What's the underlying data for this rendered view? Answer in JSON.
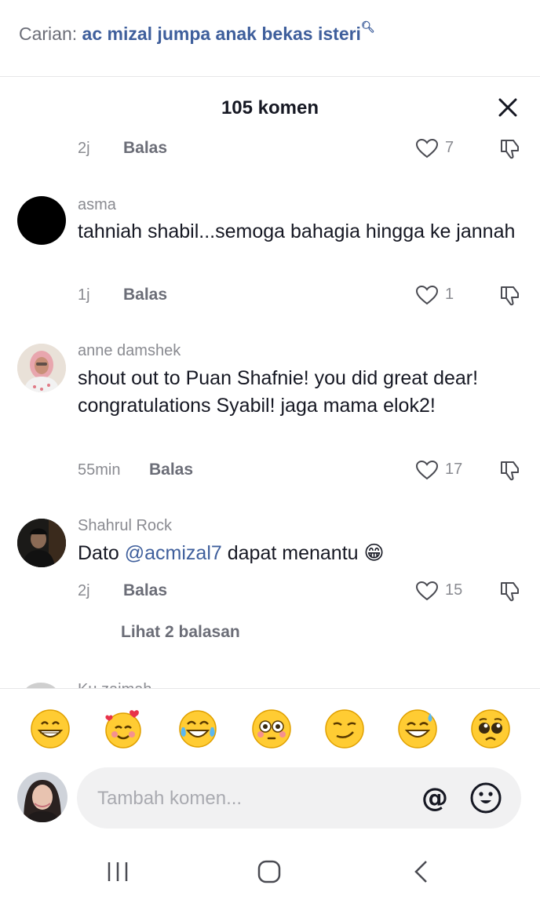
{
  "search": {
    "prefix": "Carian:",
    "query": "ac mizal jumpa anak bekas isteri",
    "icon": "search-icon"
  },
  "sheet": {
    "title": "105 komen",
    "close_icon": "close-icon"
  },
  "partial_comment": {
    "time": "2j",
    "reply_label": "Balas",
    "likes": "7"
  },
  "comments": [
    {
      "username": "asma",
      "text": "tahniah shabil...semoga bahagia hingga ke jannah",
      "time": "1j",
      "reply_label": "Balas",
      "likes": "1",
      "avatar": "black-circle-avatar"
    },
    {
      "username": "anne damshek",
      "text": "shout out to Puan Shafnie! you did great dear! congratulations Syabil! jaga mama elok2!",
      "time": "55min",
      "reply_label": "Balas",
      "likes": "17",
      "avatar": "user-photo-avatar"
    },
    {
      "username": "Shahrul Rock",
      "text_before": "Dato ",
      "mention": "@acmizal7",
      "text_after": " dapat menantu 😁",
      "time": "2j",
      "reply_label": "Balas",
      "likes": "15",
      "avatar": "user-photo-avatar"
    }
  ],
  "view_replies": "Lihat 2 balasan",
  "peek_username": "Ku zaimah",
  "emoji_bar": [
    "😁",
    "🥰",
    "😂",
    "😳",
    "😏",
    "😅",
    "🥺"
  ],
  "composer": {
    "placeholder": "Tambah komen...",
    "mention_symbol": "@",
    "emoji_icon": "emoji-smile-icon"
  },
  "colors": {
    "mention_blue": "#3f5f9c",
    "secondary_text": "#8a8b91",
    "input_bg": "#f1f1f2"
  }
}
